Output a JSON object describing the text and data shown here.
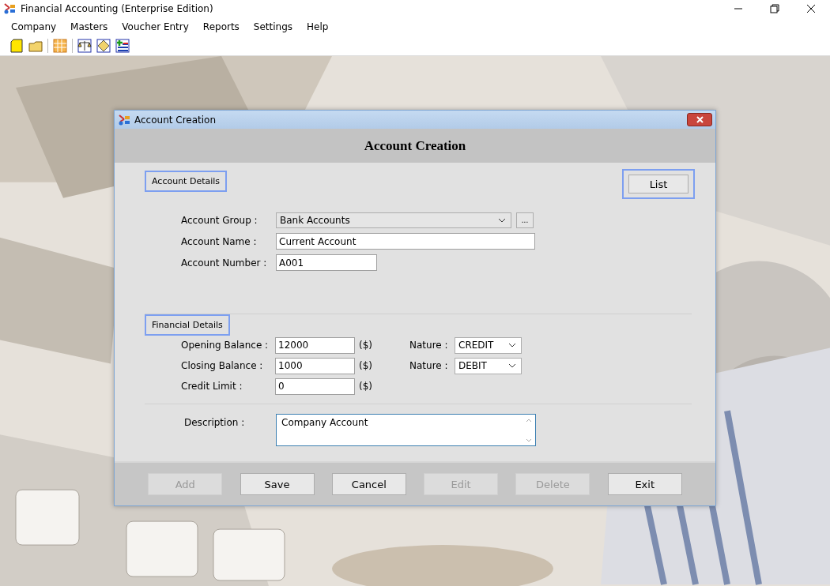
{
  "window": {
    "title": "Financial Accounting (Enterprise Edition)"
  },
  "menu": [
    "Company",
    "Masters",
    "Voucher Entry",
    "Reports",
    "Settings",
    "Help"
  ],
  "dialog": {
    "title": "Account Creation",
    "heading": "Account Creation",
    "list_button": "List",
    "account_details": {
      "legend": "Account Details",
      "fields": [
        {
          "kind": "dropdown",
          "label": "Account Group :",
          "value": "Bank Accounts",
          "browse": "..."
        },
        {
          "kind": "text",
          "label": "Account Name :",
          "value": "Current Account"
        },
        {
          "kind": "text",
          "label": "Account Number :",
          "value": "A001"
        }
      ]
    },
    "financial_details": {
      "legend": "Financial Details",
      "rows": [
        {
          "label": "Opening Balance :",
          "value": "12000",
          "unit": "($)",
          "nature_label": "Nature :",
          "nature": "CREDIT"
        },
        {
          "label": "Closing Balance :",
          "value": "1000",
          "unit": "($)",
          "nature_label": "Nature :",
          "nature": "DEBIT"
        },
        {
          "label": "Credit Limit :",
          "value": "0",
          "unit": "($)"
        }
      ]
    },
    "description": {
      "label": "Description :",
      "value": "Company Account"
    },
    "buttons": [
      {
        "label": "Add",
        "disabled": true
      },
      {
        "label": "Save",
        "disabled": false
      },
      {
        "label": "Cancel",
        "disabled": false
      },
      {
        "label": "Edit",
        "disabled": true
      },
      {
        "label": "Delete",
        "disabled": true
      },
      {
        "label": "Exit",
        "disabled": false
      }
    ]
  }
}
